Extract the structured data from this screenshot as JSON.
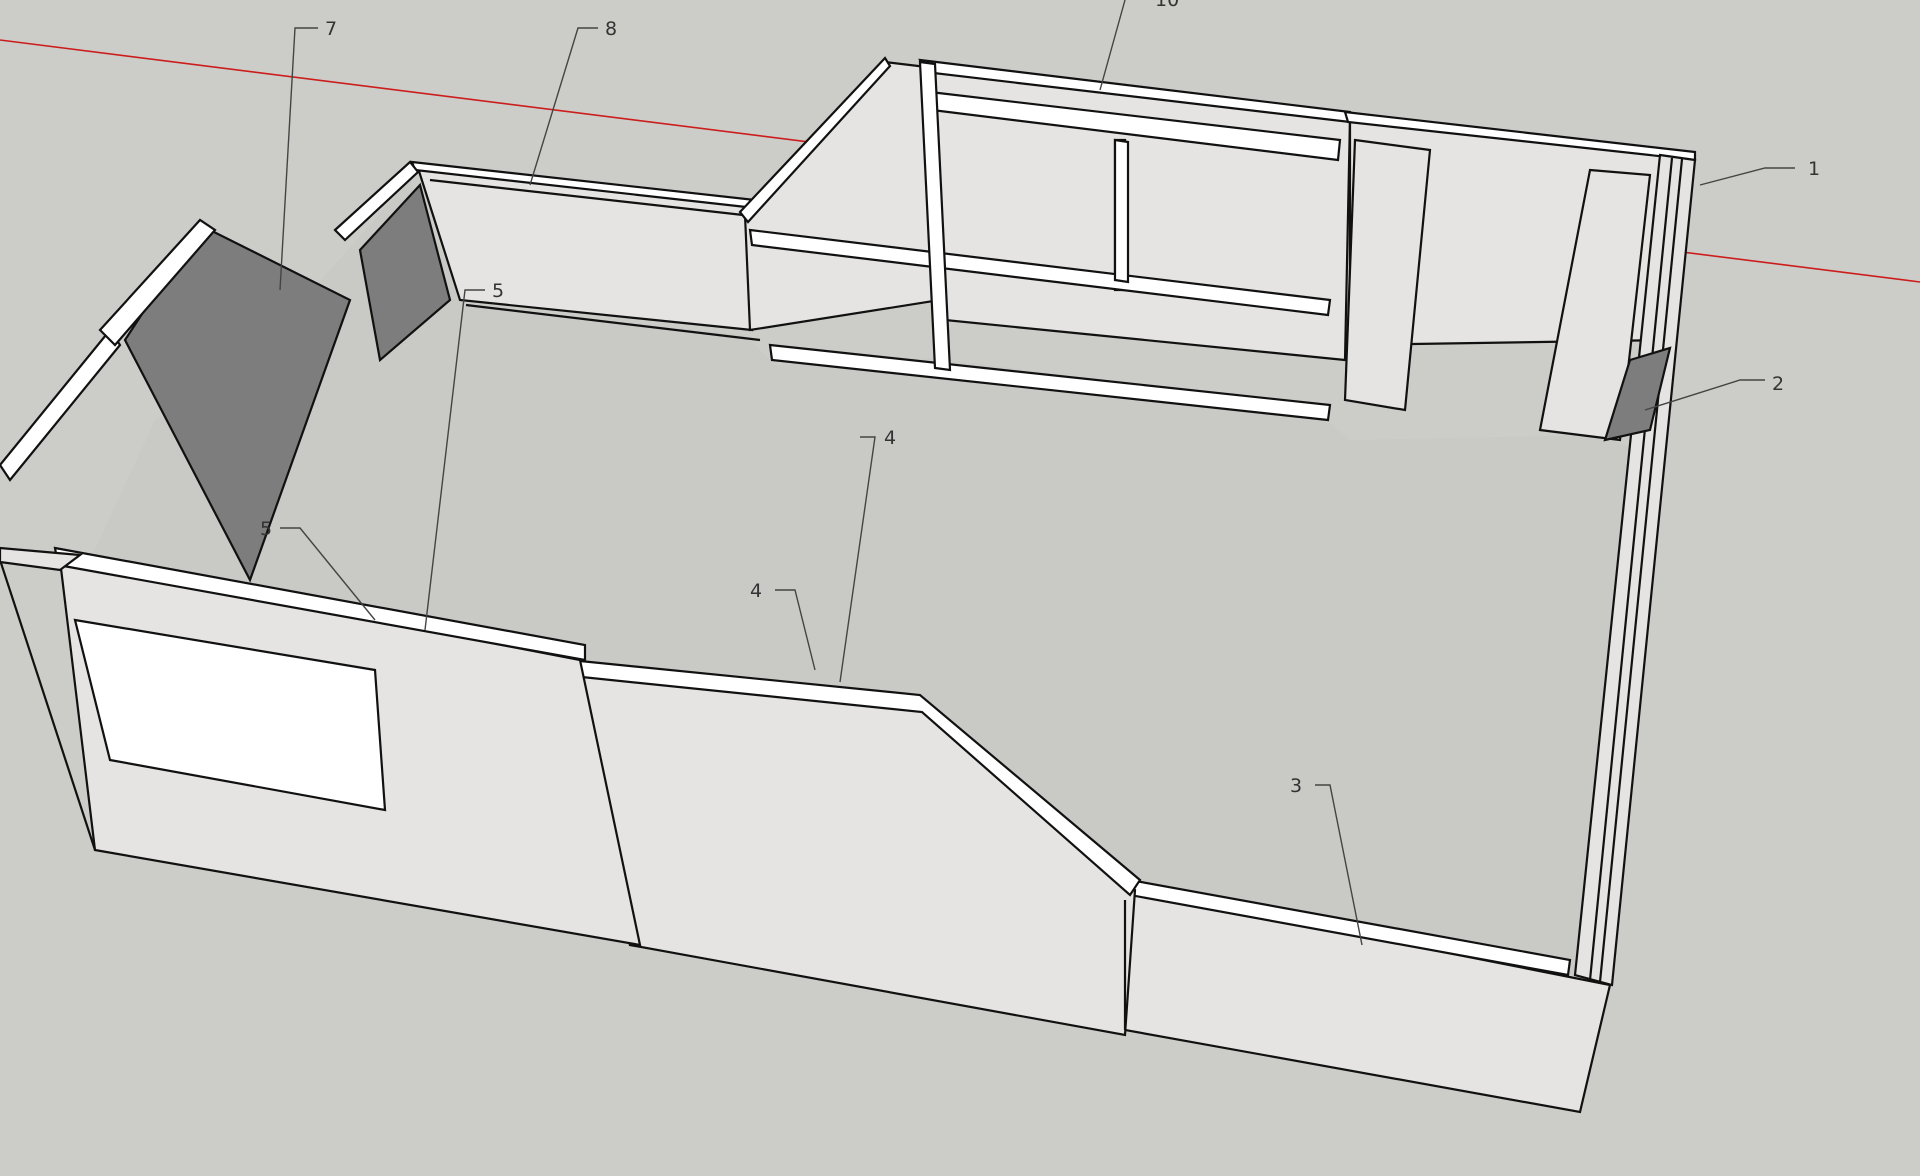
{
  "colors": {
    "background": "#cccdc8",
    "floor": "#c9cac5",
    "wall_light": "#e6e4e2",
    "wall_dark": "#7d7d7d",
    "edge": "#111111",
    "axis_red": "#cc1d1d",
    "label_text": "#333333"
  },
  "callouts": [
    {
      "id": "1",
      "text": "1"
    },
    {
      "id": "2",
      "text": "2"
    },
    {
      "id": "3",
      "text": "3"
    },
    {
      "id": "4a",
      "text": "4"
    },
    {
      "id": "4b",
      "text": "4"
    },
    {
      "id": "5a",
      "text": "5"
    },
    {
      "id": "5b",
      "text": "5"
    },
    {
      "id": "7",
      "text": "7"
    },
    {
      "id": "8",
      "text": "8"
    },
    {
      "id": "10",
      "text": "10"
    }
  ]
}
